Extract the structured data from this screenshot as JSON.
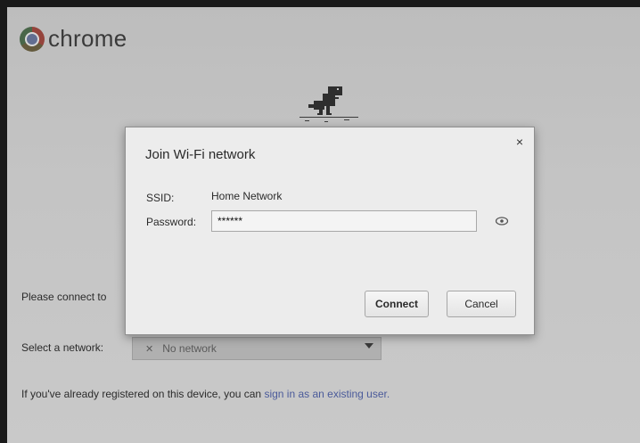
{
  "brand": {
    "name": "chrome",
    "icon": "chrome-logo-icon"
  },
  "background": {
    "connect_prompt": "Please connect to",
    "select_network_label": "Select a network:",
    "network_value": "No network",
    "registered_prefix": "If you've already registered on this device, you can ",
    "registered_link": "sign in as an existing user."
  },
  "dialog": {
    "title": "Join Wi-Fi network",
    "ssid_label": "SSID:",
    "ssid_value": "Home Network",
    "password_label": "Password:",
    "password_value": "******",
    "connect_label": "Connect",
    "cancel_label": "Cancel",
    "close_glyph": "×"
  }
}
